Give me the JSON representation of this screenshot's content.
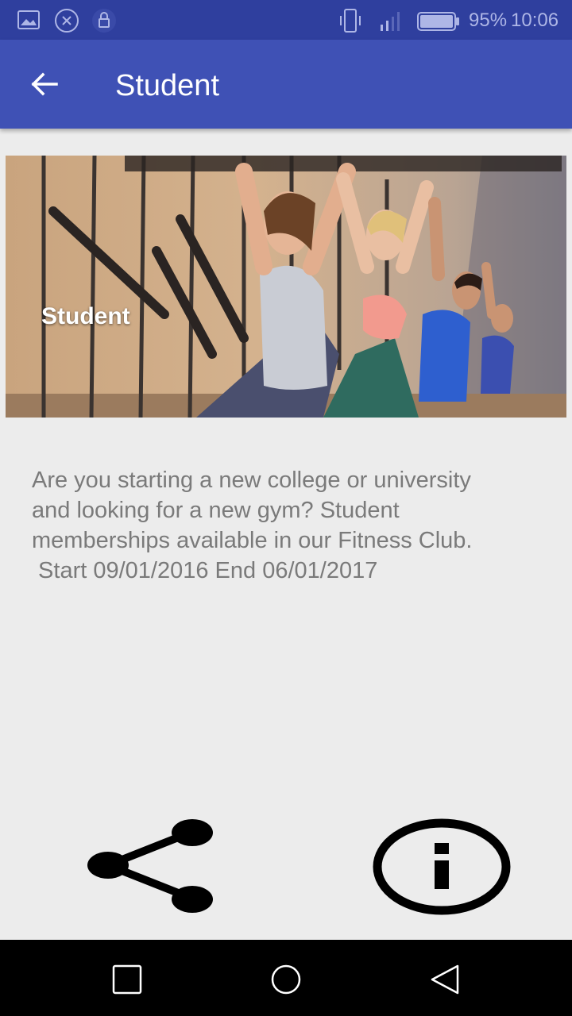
{
  "status_bar": {
    "battery_percent": "95%",
    "time": "10:06",
    "icons": [
      "gallery-notification-icon",
      "sync-notification-icon",
      "lock-notification-icon",
      "vibrate-icon",
      "signal-icon",
      "battery-icon"
    ]
  },
  "app_bar": {
    "title": "Student",
    "back_icon": "arrow-left-icon"
  },
  "hero": {
    "caption": "Student",
    "image": "fitness-class-photo"
  },
  "description": {
    "lines": [
      "Are you starting a new college or university",
      "and looking for a new gym? Student",
      "memberships available in our Fitness Club.",
      " Start 09/01/2016 End 06/01/2017"
    ]
  },
  "actions": {
    "share_icon": "share-icon",
    "info_icon": "info-icon"
  },
  "nav_bar": {
    "icons": [
      "recents-square-icon",
      "home-circle-icon",
      "back-triangle-icon"
    ]
  },
  "colors": {
    "status_bar": "#2f3f9e",
    "app_bar": "#3f51b5",
    "background": "#ececec",
    "text": "#7a7a7a"
  }
}
